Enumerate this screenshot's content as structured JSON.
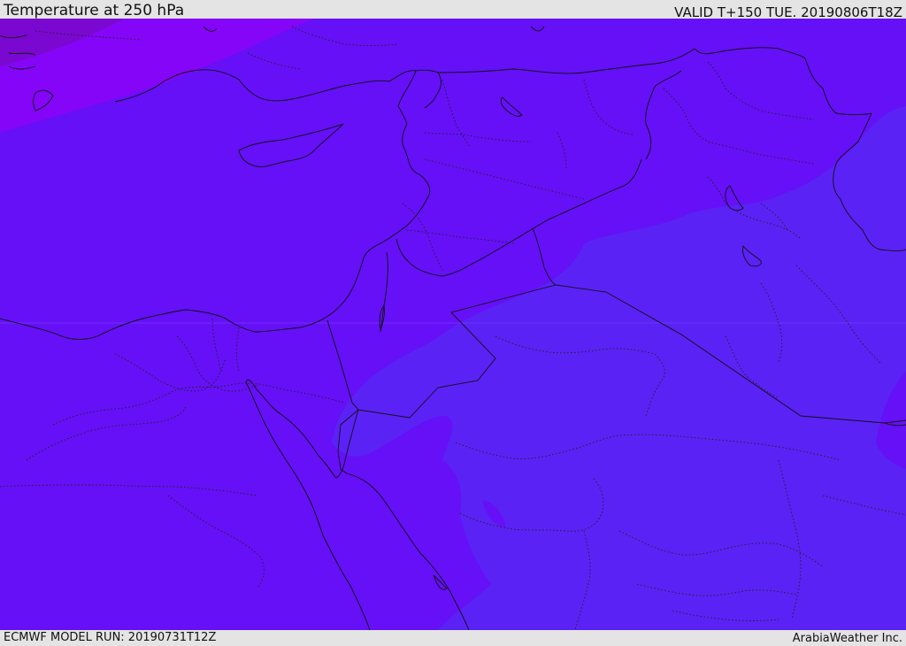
{
  "header": {
    "title": "Temperature at 250 hPa",
    "valid": "VALID T+150 TUE. 20190806T18Z"
  },
  "footer": {
    "model_run": "ECMWF MODEL RUN: 20190731T12Z",
    "credit": "ArabiaWeather Inc."
  },
  "colors": {
    "background": "#e4e4e4",
    "warm_band": "#8405f7",
    "mid_band": "#6510f7",
    "cool_band": "#5a22f5",
    "deep_warm": "#6a0ad8",
    "borders": "#111111"
  }
}
